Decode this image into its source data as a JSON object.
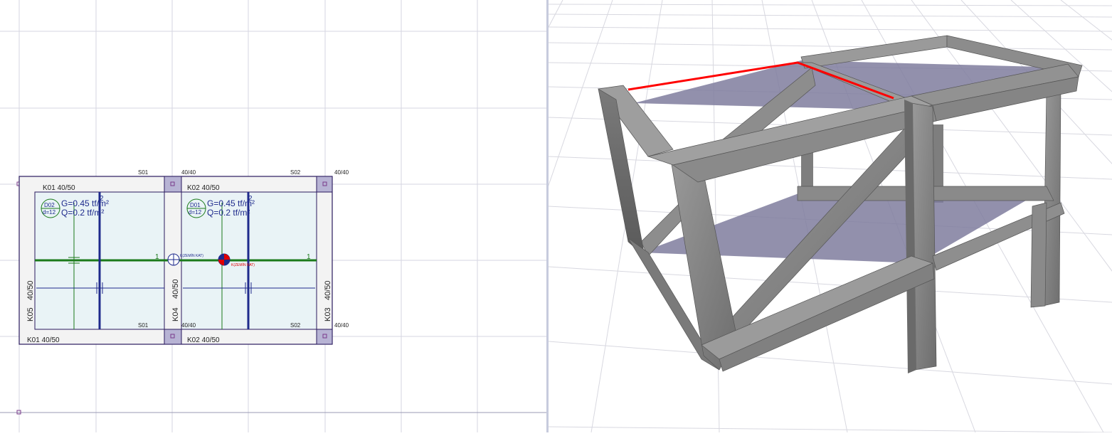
{
  "plan": {
    "slabs": [
      {
        "name": "D02",
        "thickness": "d=12",
        "g_load": "G=0.45 tf/m²",
        "q_load": "Q=0.2 tf/m²"
      },
      {
        "name": "D01",
        "thickness": "d=12",
        "g_load": "G=0.45 tf/m²",
        "q_load": "Q=0.2 tf/m²"
      }
    ],
    "beams": {
      "top_left": "K01   40/50",
      "top_right": "K02   40/50",
      "bottom_left": "K01   40/50",
      "bottom_right": "K02   40/50",
      "left": "40/50",
      "left_name": "K05",
      "middle": "40/50",
      "middle_name": "K04",
      "right": "40/50",
      "right_name": "K03"
    },
    "columns": {
      "s01_top": "S01",
      "s02_top": "S02",
      "s01_bottom": "S01",
      "s02_bottom": "S02",
      "size_1": "40/40",
      "size_2": "40/40",
      "size_3": "40/40",
      "size_4": "40/40"
    },
    "axes": {
      "axis_1_left": "1",
      "axis_1_right": "1",
      "axis_2_left": "2",
      "axis_2_right": "2"
    },
    "ground_marker_1": "K(ZEMİN KAT)",
    "ground_marker_2": "K(ZEMİN KAT)",
    "colors": {
      "slab_fill": "#e9f3f6",
      "beam_outline": "#2a1a5e",
      "axis_green": "#1a7a1a",
      "axis_blue": "#1e2a8c",
      "selected_red": "#e00000"
    }
  },
  "view3d": {
    "colors": {
      "concrete": "#8a8a8a",
      "glass": "#8c8aa8",
      "highlight": "#ff0000",
      "grid": "#d8d8e0"
    }
  }
}
